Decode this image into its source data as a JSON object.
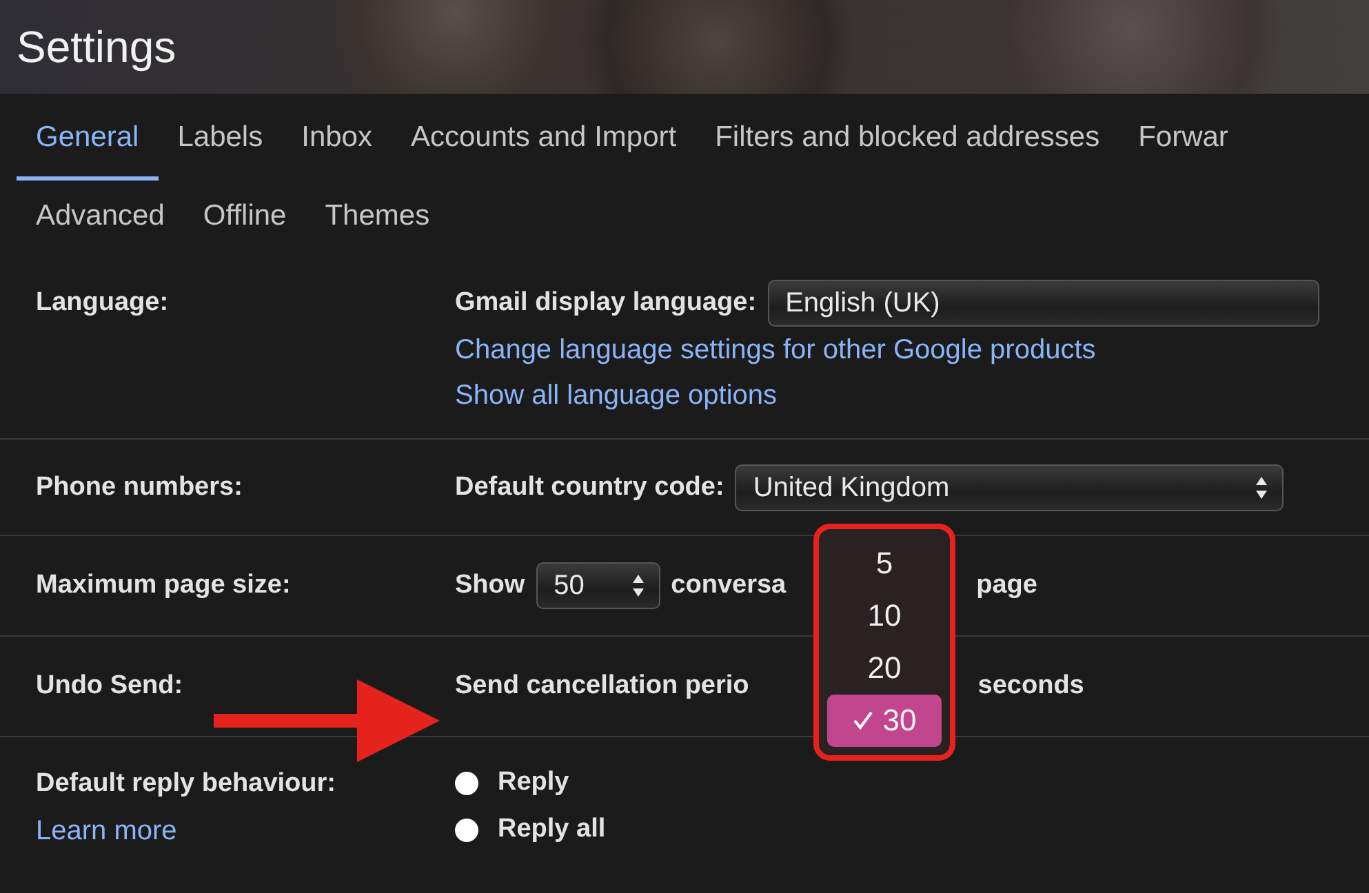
{
  "header": {
    "title": "Settings"
  },
  "tabs": [
    {
      "label": "General",
      "selected": true
    },
    {
      "label": "Labels",
      "selected": false
    },
    {
      "label": "Inbox",
      "selected": false
    },
    {
      "label": "Accounts and Import",
      "selected": false
    },
    {
      "label": "Filters and blocked addresses",
      "selected": false
    },
    {
      "label": "Forwar",
      "selected": false
    }
  ],
  "tabs_row_2": [
    {
      "label": "Advanced",
      "selected": false
    },
    {
      "label": "Offline",
      "selected": false
    },
    {
      "label": "Themes",
      "selected": false
    }
  ],
  "language": {
    "label": "Language:",
    "field_label": "Gmail display language:",
    "value": "English (UK)",
    "links": [
      "Change language settings for other Google products",
      "Show all language options"
    ]
  },
  "phone_numbers": {
    "label": "Phone numbers:",
    "field_label": "Default country code:",
    "value": "United Kingdom"
  },
  "page_size": {
    "label": "Maximum page size:",
    "before": "Show",
    "value": "50",
    "after_visible": "conversa",
    "end": "page"
  },
  "undo_send": {
    "label": "Undo Send:",
    "before_visible": "Send cancellation perio",
    "end": "seconds"
  },
  "reply_behaviour": {
    "label": "Default reply behaviour:",
    "link": "Learn more",
    "options": [
      {
        "label": "Reply",
        "selected": false
      },
      {
        "label": "Reply all",
        "selected": false
      }
    ]
  },
  "dropdown": {
    "options": [
      {
        "label": "5",
        "selected": false
      },
      {
        "label": "10",
        "selected": false
      },
      {
        "label": "20",
        "selected": false
      },
      {
        "label": "30",
        "selected": true
      }
    ]
  }
}
